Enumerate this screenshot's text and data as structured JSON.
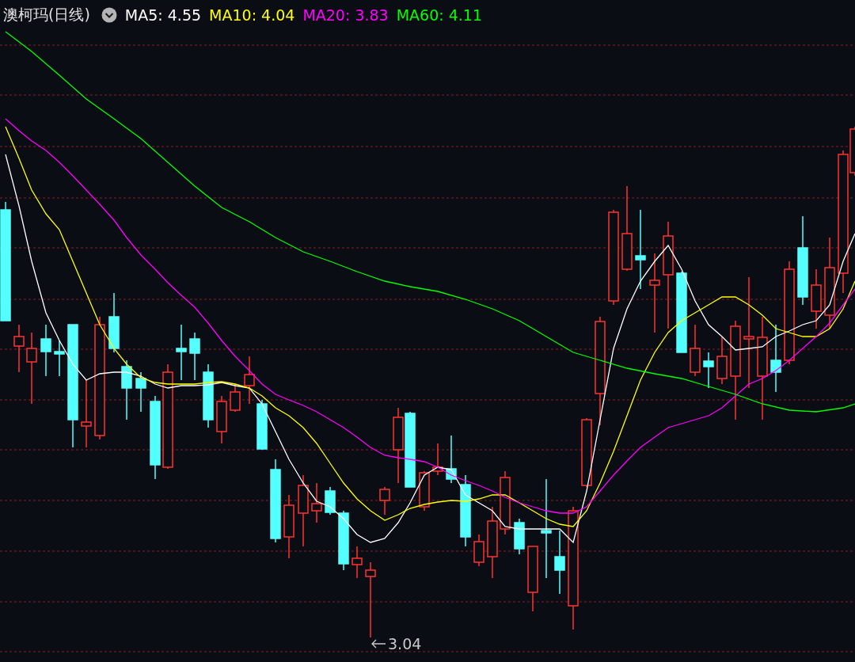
{
  "header": {
    "title": "澳柯玛(日线)",
    "indicators": [
      {
        "label": "MA5: 4.55",
        "color": "#ffffff"
      },
      {
        "label": "MA10: 4.04",
        "color": "#ffff00"
      },
      {
        "label": "MA20: 3.83",
        "color": "#ff00ff"
      },
      {
        "label": "MA60: 4.11",
        "color": "#00ff00"
      }
    ]
  },
  "chart": {
    "low_marker": "3.04"
  }
}
